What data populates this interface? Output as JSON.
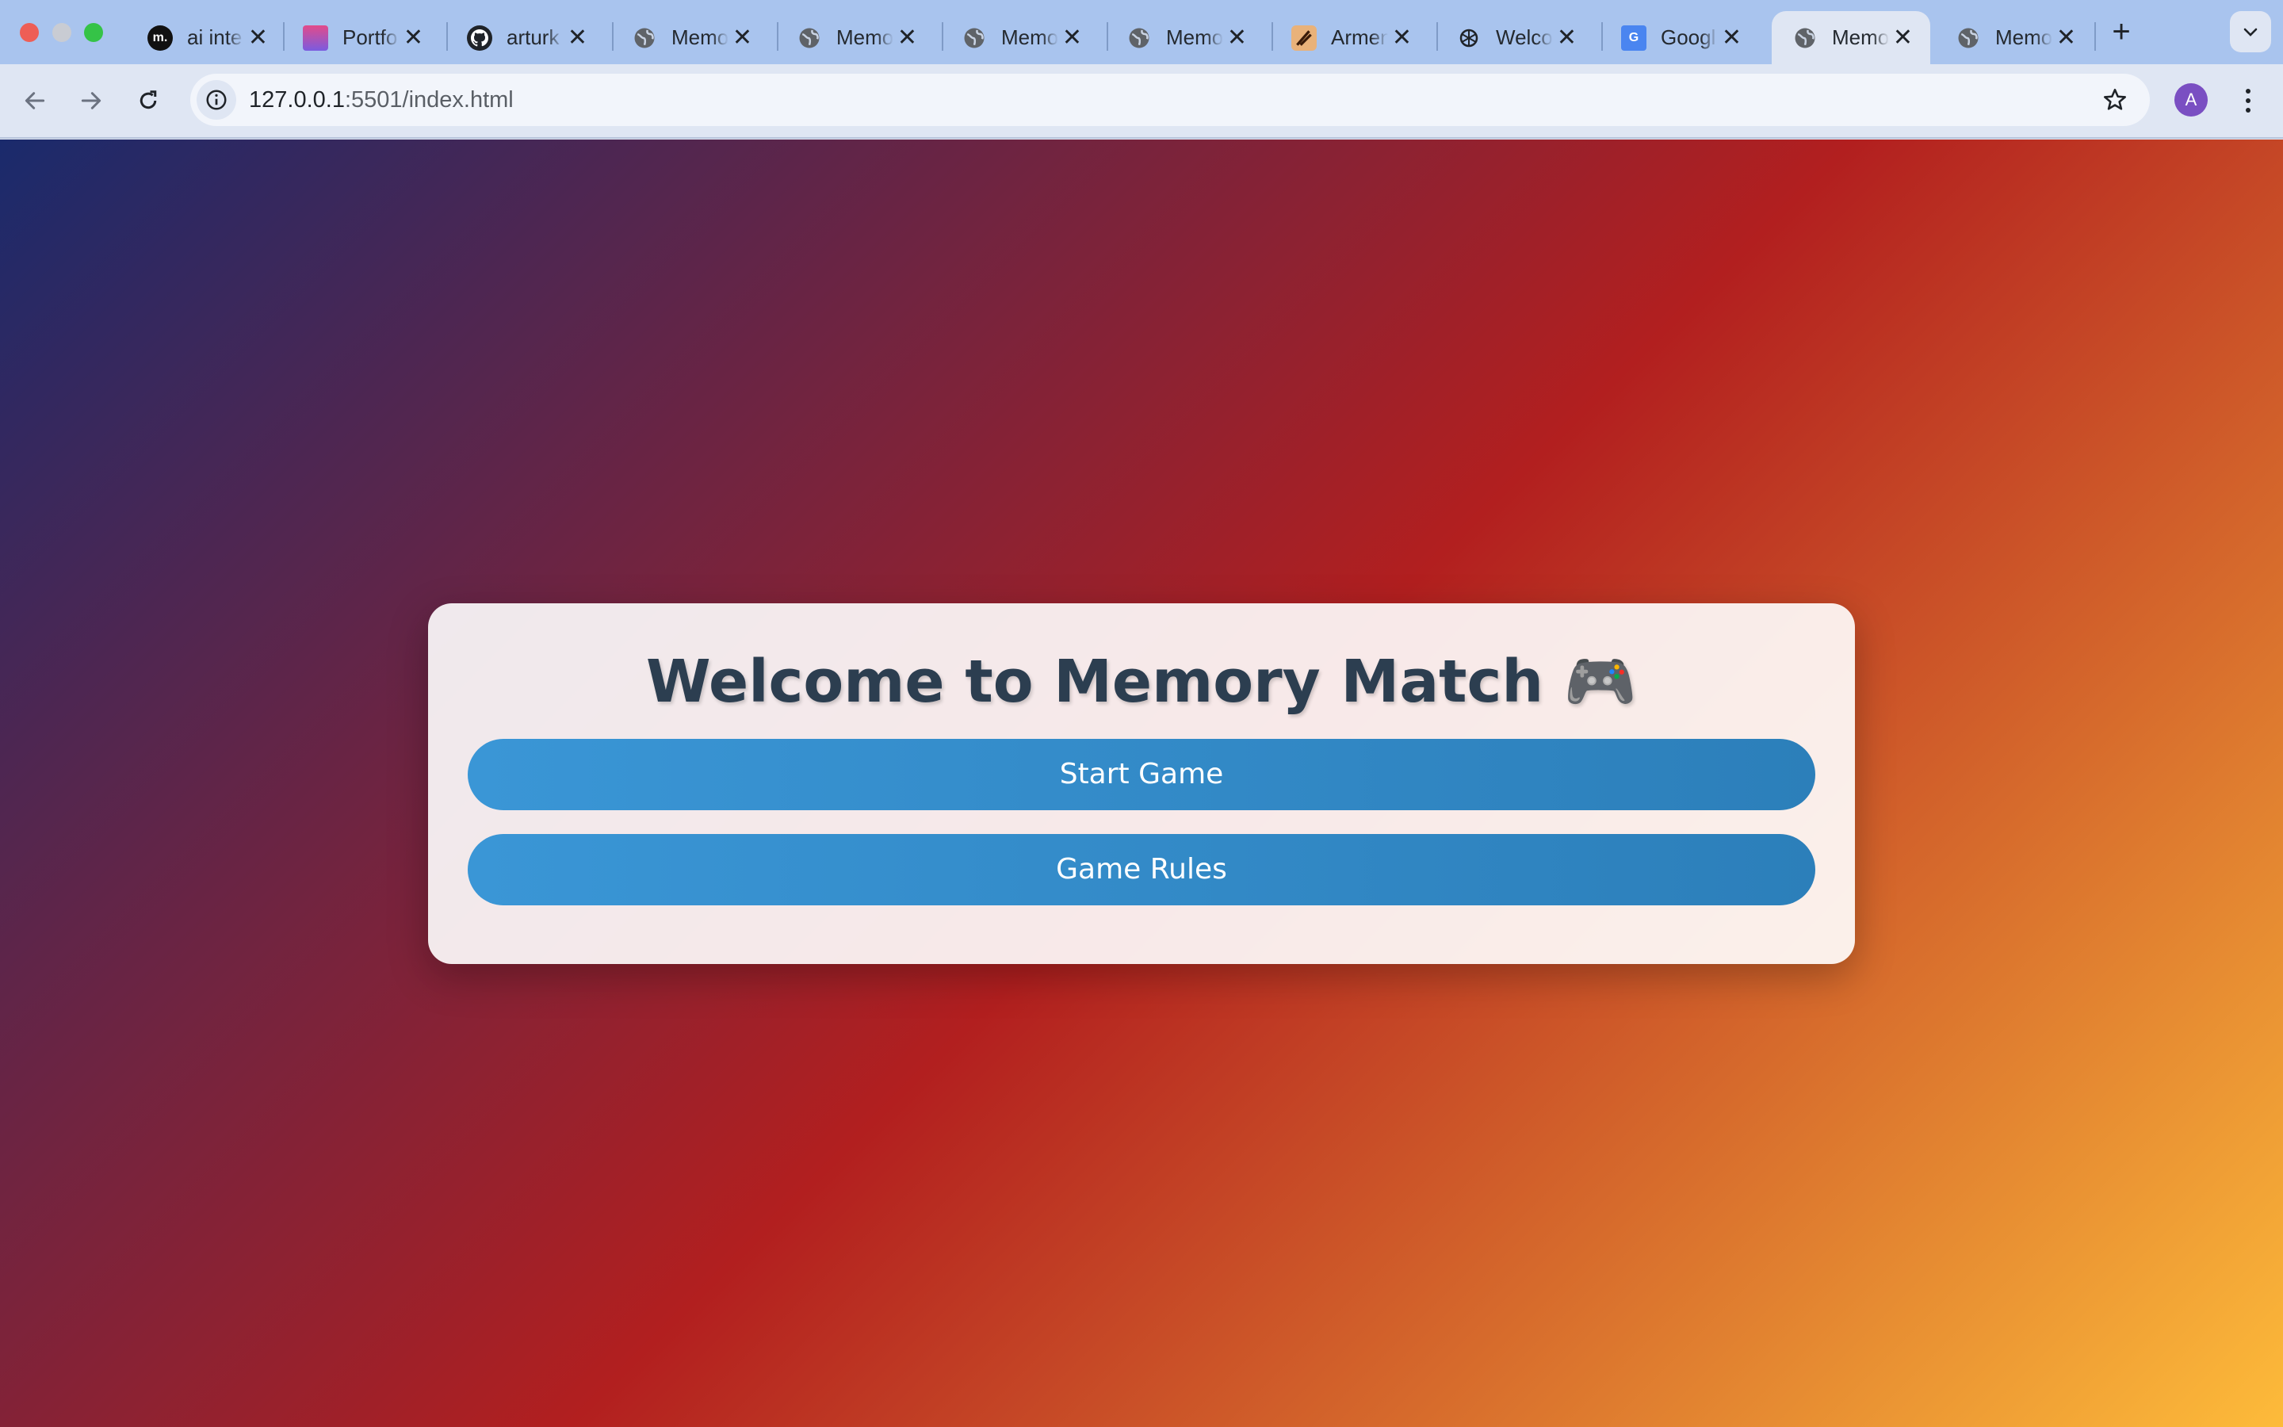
{
  "browser": {
    "tabs": [
      {
        "title": "ai inte",
        "favicon": "medium-icon"
      },
      {
        "title": "Portfo",
        "favicon": "portfolio-icon"
      },
      {
        "title": "arturk",
        "favicon": "github-icon"
      },
      {
        "title": "Memo",
        "favicon": "globe-icon"
      },
      {
        "title": "Memo",
        "favicon": "globe-icon"
      },
      {
        "title": "Memo",
        "favicon": "globe-icon"
      },
      {
        "title": "Memo",
        "favicon": "globe-icon"
      },
      {
        "title": "Armen",
        "favicon": "armen-icon"
      },
      {
        "title": "Welco",
        "favicon": "openai-icon"
      },
      {
        "title": "Googl",
        "favicon": "google-translate-icon"
      },
      {
        "title": "Memo",
        "favicon": "globe-icon",
        "active": true
      },
      {
        "title": "Memo",
        "favicon": "globe-icon"
      }
    ],
    "address_bar": {
      "host": "127.0.0.1",
      "path": ":5501/index.html"
    },
    "profile_initial": "A",
    "colors": {
      "tabstrip": "#a9c4ee",
      "toolbar": "#dfe6f3",
      "avatar": "#7a4fc2"
    }
  },
  "page": {
    "title": "Welcome to Memory Match 🎮",
    "buttons": {
      "start": "Start Game",
      "rules": "Game Rules"
    },
    "colors": {
      "gradient_start": "#1a2a6c",
      "gradient_mid": "#b21f1f",
      "gradient_end": "#fdbb3a",
      "title_text": "#2c3e50",
      "button": "#3498db"
    }
  }
}
